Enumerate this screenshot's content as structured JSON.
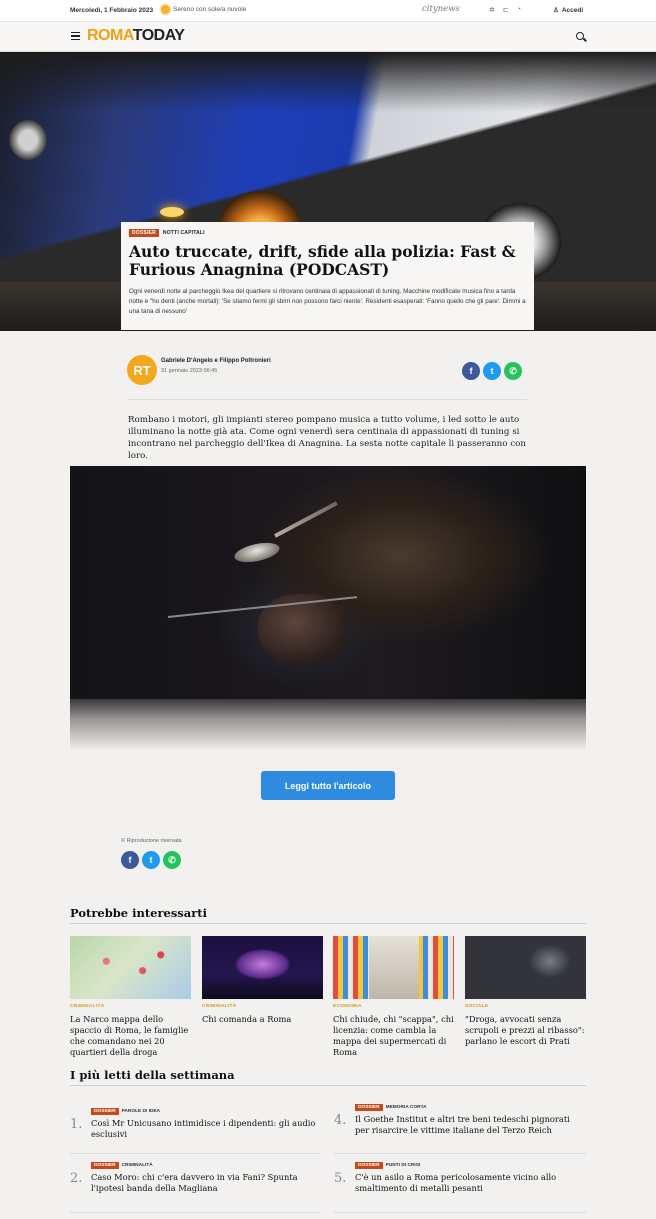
{
  "topbar": {
    "date": "Mercoledì, 1 Febbraio 2023",
    "weather": "Sereno con sole/a nuvole",
    "network": "citynews",
    "login": "Accedi"
  },
  "header": {
    "logo_roma": "ROMA",
    "logo_today": "TODAY"
  },
  "hero": {
    "tag": "DOSSIER",
    "category": "NOTTI CAPITALI",
    "title": "Auto truccate, drift, sfide alla polizia: Fast & Furious Anagnina (PODCAST)",
    "subtitle": "Ogni venerdì notte al parcheggio Ikea del quartiere si ritrovano centinaia di appassionati di tuning. Macchine modificate musica fino a tarda notte e \"ho denti (anche mortali): 'Se stiamo fermi gli sbirri non possono farci niente'. Residenti esasperati: 'Fanno quello che gli pare'. Dimmi a una tana di nessuno'"
  },
  "author": {
    "initials": "RT",
    "name": "Gabriele D'Angelo e Filippo Poltronieri",
    "date": "31 gennaio 2023 06:45"
  },
  "article": {
    "lead": "Rombano i motori, gli impianti stereo pompano musica a tutto volume, i led sotto le auto illuminano la notte già ata. Come ogni venerdì sera centinaia di appassionati di tuning si incontrano nel parcheggio dell'Ikea di Anagnina. La sesta notte capitale li passeranno con loro.",
    "read_more": "Leggi tutto l'articolo",
    "copyright": "© Riproduzione riservata"
  },
  "related": {
    "heading": "Potrebbe interessarti",
    "items": [
      {
        "category": "CRIMINALITÀ",
        "title": "La Narco mappa dello spaccio di Roma, le famiglie che comandano nei 20 quartieri della droga"
      },
      {
        "category": "CRIMINALITÀ",
        "title": "Chi comanda a Roma"
      },
      {
        "category": "ECONOMIA",
        "title": "Chi chiude, chi \"scappa\", chi licenzia: come cambia la mappa dei supermercati di Roma"
      },
      {
        "category": "SOCIALE",
        "title": "\"Droga, avvocati senza scrupoli e prezzi al ribasso\": parlano le escort di Prati"
      }
    ]
  },
  "most_read": {
    "heading": "I più letti della settimana",
    "items": [
      {
        "num": "1.",
        "tag": "DOSSIER",
        "section": "PAROLE DI IDEA",
        "title": "Così Mr Unicusano intimidisce i dipendenti: gli audio esclusivi"
      },
      {
        "num": "4.",
        "tag": "DOSSIER",
        "section": "MEMORIA CORTA",
        "title": "Il Goethe Institut e altri tre beni tedeschi pignorati per risarcire le vittime italiane del Terzo Reich"
      },
      {
        "num": "2.",
        "tag": "DOSSIER",
        "section": "CRIMINALITÀ",
        "title": "Caso Moro: chi c'era davvero in via Fani? Spunta l'ipotesi banda della Magliana"
      },
      {
        "num": "5.",
        "tag": "DOSSIER",
        "section": "PUNTI DI CRISI",
        "title": "C'è un asilo a Roma pericolosamente vicino allo smaltimento di metalli pesanti"
      }
    ]
  },
  "colors": {
    "accent": "#f0a114",
    "button": "#2f8be0",
    "tag": "#c34a1c"
  }
}
